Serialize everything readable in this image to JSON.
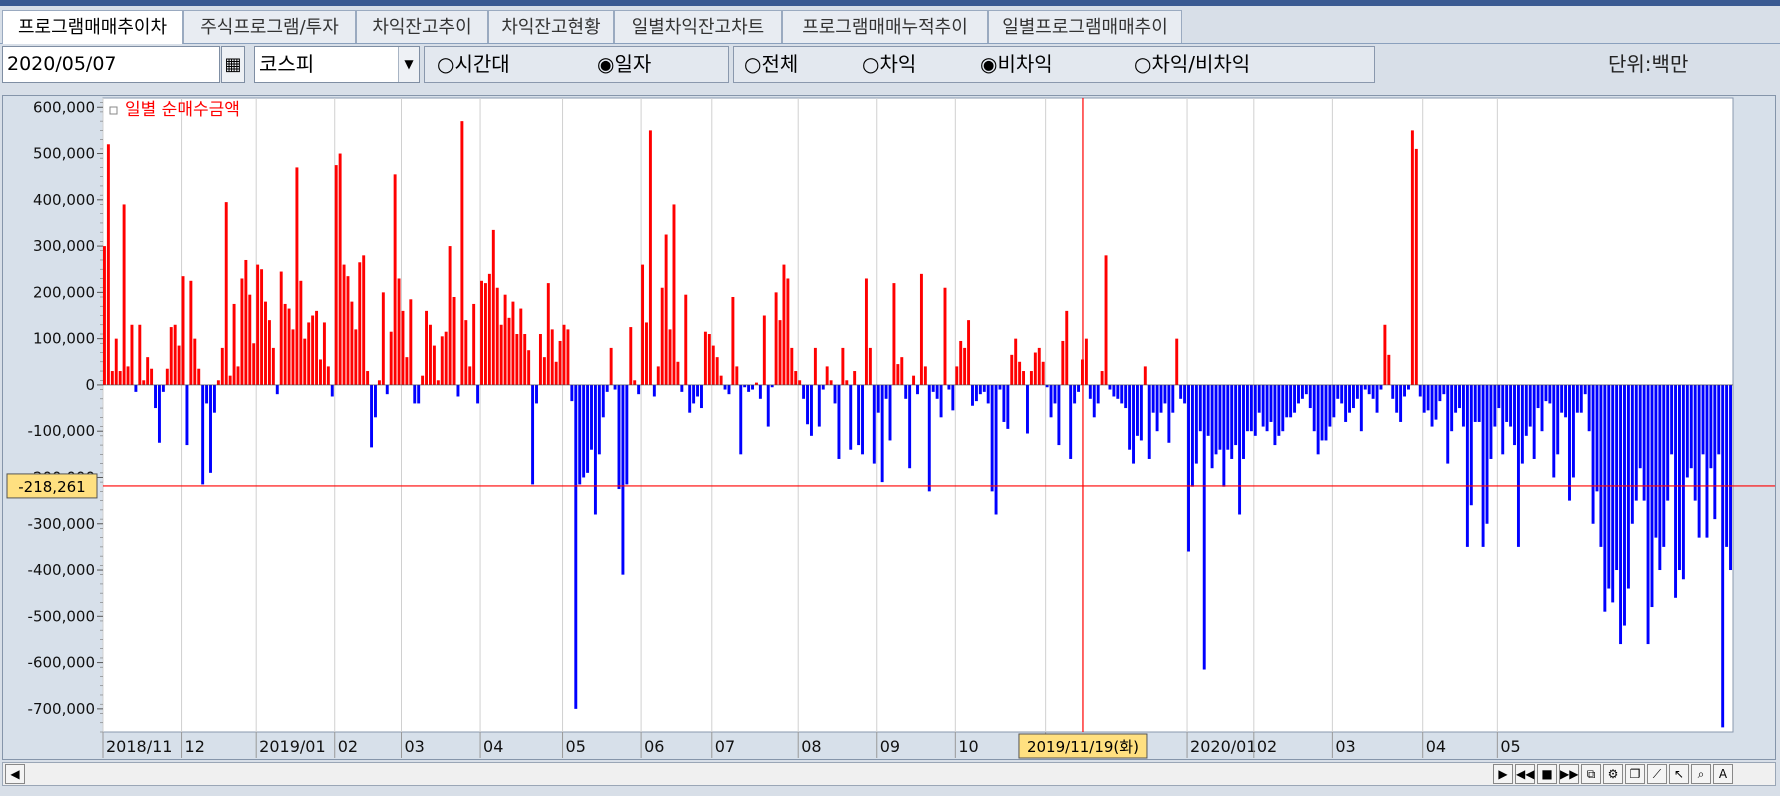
{
  "tabs": [
    "프로그램매매추이차",
    "주식프로그램/투자",
    "차익잔고추이",
    "차익잔고현황",
    "일별차익잔고차트",
    "프로그램매매누적추이",
    "일별프로그램매매추이"
  ],
  "controls": {
    "date": "2020/05/07",
    "market": "코스피",
    "period_options": [
      "○시간대",
      "◉일자"
    ],
    "type_options": [
      "○전체",
      "○차익",
      "◉비차익",
      "○차익/비차익"
    ],
    "unit": "단위:백만"
  },
  "icons": {
    "calendar": "calendar-icon",
    "dropdown": "dropdown-arrow-icon"
  },
  "chart_data": {
    "type": "bar",
    "legend": "일별 순매수금액",
    "legend_position": "top-left",
    "ylim": [
      -750000,
      620000
    ],
    "y_ticks": [
      600000,
      500000,
      400000,
      300000,
      200000,
      100000,
      0,
      -100000,
      -200000,
      -300000,
      -400000,
      -500000,
      -600000,
      -700000
    ],
    "y_tick_labels": [
      "600,000",
      "500,000",
      "400,000",
      "300,000",
      "200,000",
      "100,000",
      "0",
      "-100,000",
      "-200,000",
      "-300,000",
      "-400,000",
      "-500,000",
      "-600,000",
      "-700,000"
    ],
    "x_labels": [
      "2018/11",
      "12",
      "2019/01",
      "02",
      "03",
      "04",
      "05",
      "06",
      "07",
      "08",
      "09",
      "10",
      "11",
      "2020/01",
      "02",
      "03",
      "04",
      "05"
    ],
    "x_label_index": [
      0,
      20,
      39,
      59,
      76,
      96,
      117,
      137,
      155,
      177,
      197,
      217,
      240,
      276,
      293,
      313,
      336,
      355
    ],
    "cursor": {
      "index": 249,
      "x_label": "2019/11/19(화)",
      "y_value": -218261,
      "y_label": "-218,261"
    },
    "positive_color": "#ff0000",
    "negative_color": "#0000ff",
    "grid": true,
    "values": [
      300000,
      520000,
      30000,
      100000,
      30000,
      390000,
      40000,
      130000,
      -15000,
      130000,
      10000,
      60000,
      35000,
      -50000,
      -125000,
      -15000,
      35000,
      125000,
      130000,
      85000,
      235000,
      -130000,
      225000,
      100000,
      35000,
      -215000,
      -40000,
      -190000,
      -60000,
      10000,
      80000,
      395000,
      20000,
      175000,
      40000,
      230000,
      270000,
      195000,
      90000,
      260000,
      250000,
      180000,
      140000,
      80000,
      -20000,
      245000,
      175000,
      165000,
      120000,
      470000,
      225000,
      100000,
      135000,
      150000,
      160000,
      55000,
      135000,
      40000,
      -25000,
      475000,
      500000,
      260000,
      235000,
      180000,
      120000,
      265000,
      280000,
      30000,
      -135000,
      -70000,
      10000,
      200000,
      -20000,
      115000,
      455000,
      230000,
      160000,
      60000,
      185000,
      -40000,
      -40000,
      20000,
      160000,
      130000,
      85000,
      10000,
      105000,
      115000,
      300000,
      190000,
      -25000,
      570000,
      140000,
      40000,
      175000,
      -40000,
      225000,
      220000,
      240000,
      335000,
      210000,
      130000,
      195000,
      145000,
      180000,
      110000,
      165000,
      110000,
      75000,
      -215000,
      -40000,
      110000,
      60000,
      220000,
      120000,
      50000,
      95000,
      130000,
      120000,
      -35000,
      -700000,
      -215000,
      -200000,
      -190000,
      -140000,
      -280000,
      -150000,
      -70000,
      -15000,
      80000,
      -10000,
      -225000,
      -410000,
      -215000,
      125000,
      10000,
      -20000,
      260000,
      135000,
      550000,
      -25000,
      40000,
      210000,
      325000,
      120000,
      390000,
      50000,
      -15000,
      195000,
      -60000,
      -40000,
      -25000,
      -50000,
      115000,
      110000,
      85000,
      60000,
      20000,
      -10000,
      -20000,
      190000,
      40000,
      -150000,
      -5000,
      -15000,
      -10000,
      5000,
      -30000,
      150000,
      -90000,
      -5000,
      200000,
      140000,
      260000,
      230000,
      80000,
      30000,
      10000,
      -30000,
      -85000,
      -110000,
      80000,
      -90000,
      -10000,
      40000,
      10000,
      -40000,
      -160000,
      80000,
      10000,
      -140000,
      30000,
      -130000,
      -150000,
      230000,
      80000,
      -170000,
      -60000,
      -210000,
      -30000,
      -120000,
      220000,
      45000,
      60000,
      -30000,
      -180000,
      20000,
      -20000,
      240000,
      40000,
      -230000,
      -15000,
      -30000,
      -70000,
      210000,
      -10000,
      -55000,
      40000,
      95000,
      80000,
      140000,
      -45000,
      -35000,
      -20000,
      -15000,
      -40000,
      -230000,
      -280000,
      -10000,
      -80000,
      -95000,
      65000,
      100000,
      50000,
      30000,
      -105000,
      30000,
      70000,
      80000,
      50000,
      -5000,
      -70000,
      -40000,
      -130000,
      95000,
      160000,
      -160000,
      -40000,
      -15000,
      55000,
      100000,
      -30000,
      -70000,
      -40000,
      30000,
      280000,
      -10000,
      -25000,
      -30000,
      -40000,
      -50000,
      -140000,
      -170000,
      -110000,
      -120000,
      40000,
      -160000,
      -60000,
      -100000,
      -60000,
      -40000,
      -125000,
      -60000,
      100000,
      -30000,
      -40000,
      -360000,
      -220000,
      -170000,
      -100000,
      -615000,
      -110000,
      -180000,
      -150000,
      -140000,
      -220000,
      -140000,
      -160000,
      -130000,
      -280000,
      -160000,
      -100000,
      -100000,
      -110000,
      -60000,
      -90000,
      -100000,
      -80000,
      -130000,
      -110000,
      -100000,
      -70000,
      -70000,
      -60000,
      -40000,
      -30000,
      -20000,
      -50000,
      -100000,
      -150000,
      -120000,
      -120000,
      -90000,
      -70000,
      -30000,
      -40000,
      -80000,
      -60000,
      -50000,
      -30000,
      -100000,
      -10000,
      -20000,
      -30000,
      -60000,
      -10000,
      130000,
      65000,
      -30000,
      -60000,
      -80000,
      -25000,
      -10000,
      550000,
      510000,
      -25000,
      -60000,
      -55000,
      -90000,
      -75000,
      -35000,
      -20000,
      -170000,
      -100000,
      -60000,
      -50000,
      -90000,
      -350000,
      -260000,
      -80000,
      -80000,
      -350000,
      -300000,
      -160000,
      -90000,
      -50000,
      -150000,
      -80000,
      -90000,
      -130000,
      -350000,
      -170000,
      -110000,
      -90000,
      -160000,
      -50000,
      -100000,
      -35000,
      -40000,
      -200000,
      -150000,
      -60000,
      -70000,
      -250000,
      -200000,
      -60000,
      -60000,
      -20000,
      -100000,
      -300000,
      -230000,
      -350000,
      -490000,
      -440000,
      -470000,
      -400000,
      -560000,
      -520000,
      -440000,
      -300000,
      -250000,
      -180000,
      -250000,
      -560000,
      -480000,
      -330000,
      -400000,
      -350000,
      -250000,
      -150000,
      -460000,
      -400000,
      -420000,
      -200000,
      -180000,
      -250000,
      -330000,
      -150000,
      -330000,
      -180000,
      -290000,
      -150000,
      -740000,
      -350000,
      -400000
    ]
  }
}
